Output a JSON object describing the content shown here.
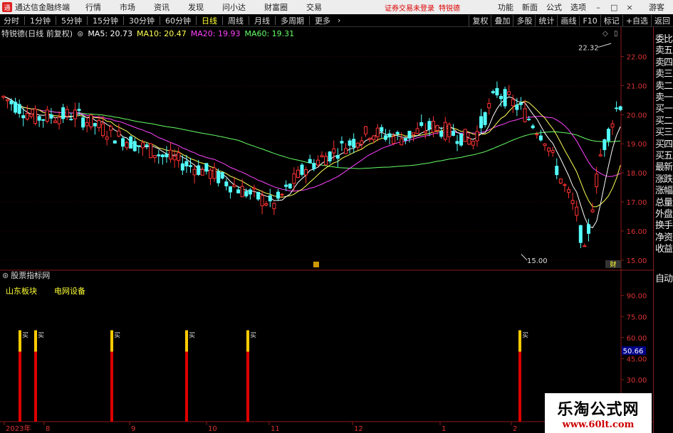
{
  "menubar": {
    "logo": "通",
    "app_title": "通达信金融终端",
    "items": [
      "行情",
      "市场",
      "资讯",
      "发现",
      "问小达",
      "财富圈",
      "交易"
    ],
    "login_notice": "证券交易未登录",
    "user": "特锐德",
    "right_items": [
      "功能",
      "新面",
      "公式",
      "选项"
    ],
    "guest": "游客"
  },
  "toolbar": {
    "periods": [
      "分时",
      "1分钟",
      "5分钟",
      "15分钟",
      "30分钟",
      "60分钟",
      "日线",
      "周线",
      "月线",
      "多周期",
      "更多"
    ],
    "active_period": "日线",
    "right_tools": [
      "复权",
      "叠加",
      "多股",
      "统计",
      "画线",
      "F10",
      "标记",
      "+自选",
      "返回"
    ]
  },
  "info": {
    "stock": "特锐德(日线 前复权)",
    "ma5": "MA5: 20.73",
    "ma10": "MA10: 20.47",
    "ma20": "MA20: 19.93",
    "ma60": "MA60: 19.31",
    "colors": {
      "ma5": "#ffffff",
      "ma10": "#ffff55",
      "ma20": "#ff44ff",
      "ma60": "#66ff66"
    }
  },
  "right_panel": {
    "items": [
      "委比",
      "卖五",
      "卖四",
      "卖三",
      "卖二",
      "卖一",
      "买一",
      "买二",
      "买三",
      "买四",
      "买五",
      "最新",
      "涨跌",
      "涨幅",
      "总量",
      "外盘",
      "换手",
      "净资",
      "收益"
    ],
    "auto": "自动"
  },
  "chart_data": [
    {
      "type": "candlestick",
      "title": "特锐德(日线 前复权)",
      "y_ticks": [
        "22.00",
        "21.00",
        "20.00",
        "19.00",
        "18.00",
        "17.00",
        "16.00",
        "15.00"
      ],
      "ylim": [
        14.8,
        22.6
      ],
      "annotations": [
        {
          "label": "22.32"
        },
        {
          "label": "15.00"
        }
      ],
      "x_labels": [
        "2023年",
        "8",
        "9",
        "10",
        "11",
        "12",
        "1",
        "2"
      ],
      "finance_badge": "财",
      "ma_series": [
        {
          "name": "MA5",
          "color": "#ffffff"
        },
        {
          "name": "MA10",
          "color": "#ffff55"
        },
        {
          "name": "MA20",
          "color": "#ff44ff"
        },
        {
          "name": "MA60",
          "color": "#66ff66"
        }
      ]
    },
    {
      "type": "bar",
      "title": "股票指标网",
      "y_ticks": [
        "90.00",
        "75.00",
        "60.00",
        "45.00",
        "30.00",
        "15.00"
      ],
      "ylim": [
        0,
        100
      ],
      "current_value": "50.66",
      "signal_label": "买",
      "signals": [
        {
          "x_index": 5,
          "value": 50
        },
        {
          "x_index": 10,
          "value": 50
        },
        {
          "x_index": 31,
          "value": 50
        },
        {
          "x_index": 52,
          "value": 50
        },
        {
          "x_index": 70,
          "value": 50
        },
        {
          "x_index": 148,
          "value": 50
        }
      ]
    }
  ],
  "indicator": {
    "name": "股票指标网",
    "sector_label": "山东板块",
    "sector_value": "电网设备"
  },
  "watermark": {
    "title": "乐淘公式网",
    "url": "www.60lt.com"
  }
}
